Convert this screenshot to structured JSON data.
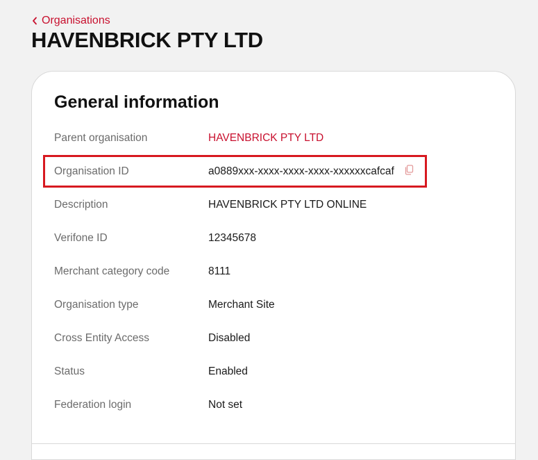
{
  "breadcrumb": {
    "back_label": "Organisations"
  },
  "page": {
    "title": "HAVENBRICK PTY LTD"
  },
  "general_info": {
    "title": "General information",
    "rows": [
      {
        "label": "Parent organisation",
        "value": "HAVENBRICK PTY LTD"
      },
      {
        "label": "Organisation ID",
        "value": "a0889xxx-xxxx-xxxx-xxxx-xxxxxxcafcaf"
      },
      {
        "label": "Description",
        "value": "HAVENBRICK PTY LTD ONLINE"
      },
      {
        "label": "Verifone ID",
        "value": "12345678"
      },
      {
        "label": "Merchant category code",
        "value": "8111"
      },
      {
        "label": "Organisation type",
        "value": "Merchant Site"
      },
      {
        "label": "Cross Entity Access",
        "value": "Disabled"
      },
      {
        "label": "Status",
        "value": "Enabled"
      },
      {
        "label": "Federation login",
        "value": "Not set"
      }
    ]
  },
  "icons": {
    "back": "chevron-left-icon",
    "copy": "copy-icon"
  },
  "colors": {
    "accent": "#c8102e",
    "highlight": "#d71920",
    "background": "#f2f2f2",
    "label": "#6b6b6b"
  }
}
